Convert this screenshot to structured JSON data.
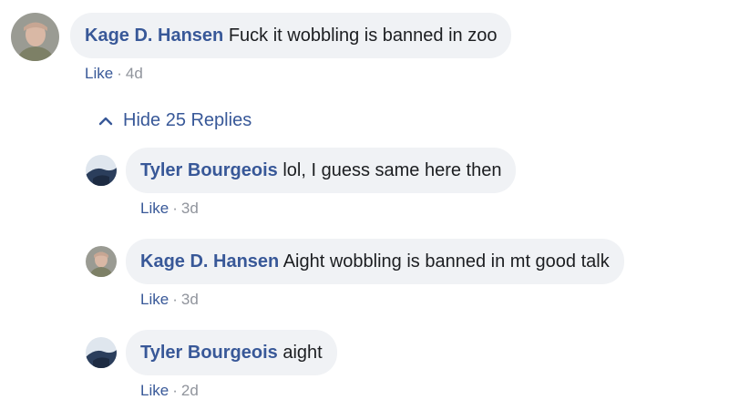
{
  "comments": [
    {
      "author": "Kage D. Hansen",
      "text": "Fuck it wobbling is banned in zoo",
      "like": "Like",
      "sep": "·",
      "time": "4d"
    },
    {
      "author": "Tyler Bourgeois",
      "text": "lol, I guess same here then",
      "like": "Like",
      "sep": "·",
      "time": "3d"
    },
    {
      "author": "Kage D. Hansen",
      "text": "Aight wobbling is banned in mt good talk",
      "like": "Like",
      "sep": "·",
      "time": "3d"
    },
    {
      "author": "Tyler Bourgeois",
      "text": "aight",
      "like": "Like",
      "sep": "·",
      "time": "2d"
    }
  ],
  "replies_toggle": {
    "label": "Hide 25 Replies",
    "icon": "chevron-up-icon"
  },
  "colors": {
    "link": "#385898",
    "bubble": "#f0f2f5",
    "meta": "#90949c"
  }
}
